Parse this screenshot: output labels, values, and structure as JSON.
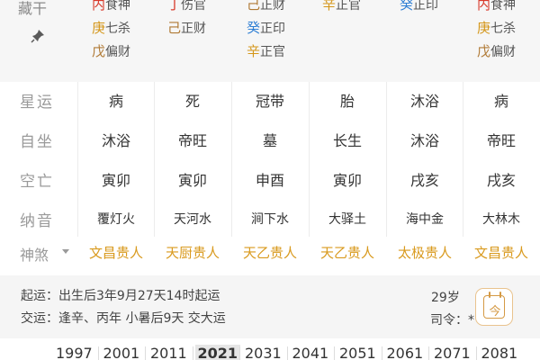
{
  "hidden_stems": {
    "label": "藏干",
    "columns": [
      {
        "lines": [
          {
            "gan": "内",
            "text": "食神",
            "color": "#d83a2c"
          },
          {
            "gan": "庚",
            "text": "七杀",
            "color": "#d49619"
          },
          {
            "gan": "戊",
            "text": "偏财",
            "color": "#b07a35"
          }
        ]
      },
      {
        "lines": [
          {
            "gan": "丁",
            "text": "伤官",
            "color": "#d83a2c"
          },
          {
            "gan": "己",
            "text": "正财",
            "color": "#b07a35"
          }
        ]
      },
      {
        "lines": [
          {
            "gan": "己",
            "text": "正财",
            "color": "#b07a35"
          },
          {
            "gan": "癸",
            "text": "正印",
            "color": "#2f7fd4"
          },
          {
            "gan": "辛",
            "text": "正官",
            "color": "#d49619"
          }
        ]
      },
      {
        "lines": [
          {
            "gan": "辛",
            "text": "正官",
            "color": "#d49619"
          }
        ]
      },
      {
        "lines": [
          {
            "gan": "癸",
            "text": "正印",
            "color": "#2f7fd4"
          }
        ]
      },
      {
        "lines": [
          {
            "gan": "内",
            "text": "食神",
            "color": "#d83a2c"
          },
          {
            "gan": "庚",
            "text": "七杀",
            "color": "#d49619"
          },
          {
            "gan": "戊",
            "text": "偏财",
            "color": "#b07a35"
          }
        ]
      }
    ]
  },
  "rows": [
    {
      "label": "星运",
      "cells": [
        "病",
        "死",
        "冠带",
        "胎",
        "沐浴",
        "病"
      ]
    },
    {
      "label": "自坐",
      "cells": [
        "沐浴",
        "帝旺",
        "墓",
        "长生",
        "沐浴",
        "帝旺"
      ]
    },
    {
      "label": "空亡",
      "cells": [
        "寅卯",
        "寅卯",
        "申酉",
        "寅卯",
        "戌亥",
        "戌亥"
      ]
    },
    {
      "label": "纳音",
      "cells": [
        "覆灯火",
        "天河水",
        "涧下水",
        "大驿土",
        "海中金",
        "大林木"
      ]
    }
  ],
  "shensha": {
    "label": "神煞",
    "items": [
      "文昌贵人",
      "天厨贵人",
      "天乙贵人",
      "天乙贵人",
      "太极贵人",
      "文昌贵人"
    ]
  },
  "info": {
    "qiyun": "起运：出生后3年9月27天14时起运",
    "jiaoyun": "交运：逢辛、丙年 小暑后9天 交大运",
    "age": "29岁",
    "siling": "司令：*",
    "calendar_label": "今"
  },
  "years": [
    "1997",
    "2001",
    "2011",
    "2021",
    "2031",
    "2041",
    "2051",
    "2061",
    "2071",
    "2081"
  ],
  "active_year": "2021"
}
